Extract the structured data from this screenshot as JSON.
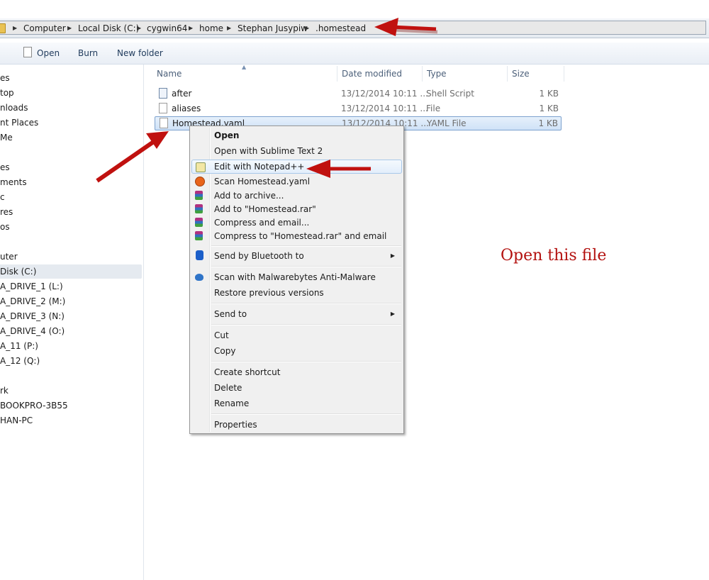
{
  "breadcrumb": [
    "Computer",
    "Local Disk (C:)",
    "cygwin64",
    "home",
    "Stephan Jusypiw",
    ".homestead"
  ],
  "toolbar": {
    "open": "Open",
    "burn": "Burn",
    "new_folder": "New folder"
  },
  "nav": [
    "es",
    "top",
    "nloads",
    "nt Places",
    "Me",
    "es",
    "ments",
    "c",
    "res",
    "os",
    "uter",
    "Disk (C:)",
    "A_DRIVE_1 (L:)",
    "A_DRIVE_2 (M:)",
    "A_DRIVE_3 (N:)",
    "A_DRIVE_4 (O:)",
    "A_11 (P:)",
    "A_12 (Q:)",
    "rk",
    "BOOKPRO-3B55",
    "HAN-PC"
  ],
  "columns": {
    "name": "Name",
    "date": "Date modified",
    "type": "Type",
    "size": "Size"
  },
  "files": [
    {
      "name": "after",
      "date": "13/12/2014 10:11 ...",
      "type": "Shell Script",
      "size": "1 KB"
    },
    {
      "name": "aliases",
      "date": "13/12/2014 10:11 ...",
      "type": "File",
      "size": "1 KB"
    },
    {
      "name": "Homestead.yaml",
      "date": "13/12/2014 10:11 ...",
      "type": "YAML File",
      "size": "1 KB"
    }
  ],
  "menu": {
    "open": "Open",
    "open_sublime": "Open with Sublime Text 2",
    "edit_notepad": "Edit with Notepad++",
    "scan": "Scan Homestead.yaml",
    "add_archive": "Add to archive...",
    "add_rar": "Add to \"Homestead.rar\"",
    "compress_email": "Compress and email...",
    "compress_rar_email": "Compress to \"Homestead.rar\" and email",
    "bluetooth": "Send by Bluetooth to",
    "malwarebytes": "Scan with Malwarebytes Anti-Malware",
    "restore": "Restore previous versions",
    "send_to": "Send to",
    "cut": "Cut",
    "copy": "Copy",
    "create_shortcut": "Create shortcut",
    "delete": "Delete",
    "rename": "Rename",
    "properties": "Properties"
  },
  "annotation": "Open this file",
  "colors": {
    "arrow": "#c0110f",
    "annotation": "#b3110f",
    "selection": "#cfe2f7"
  }
}
